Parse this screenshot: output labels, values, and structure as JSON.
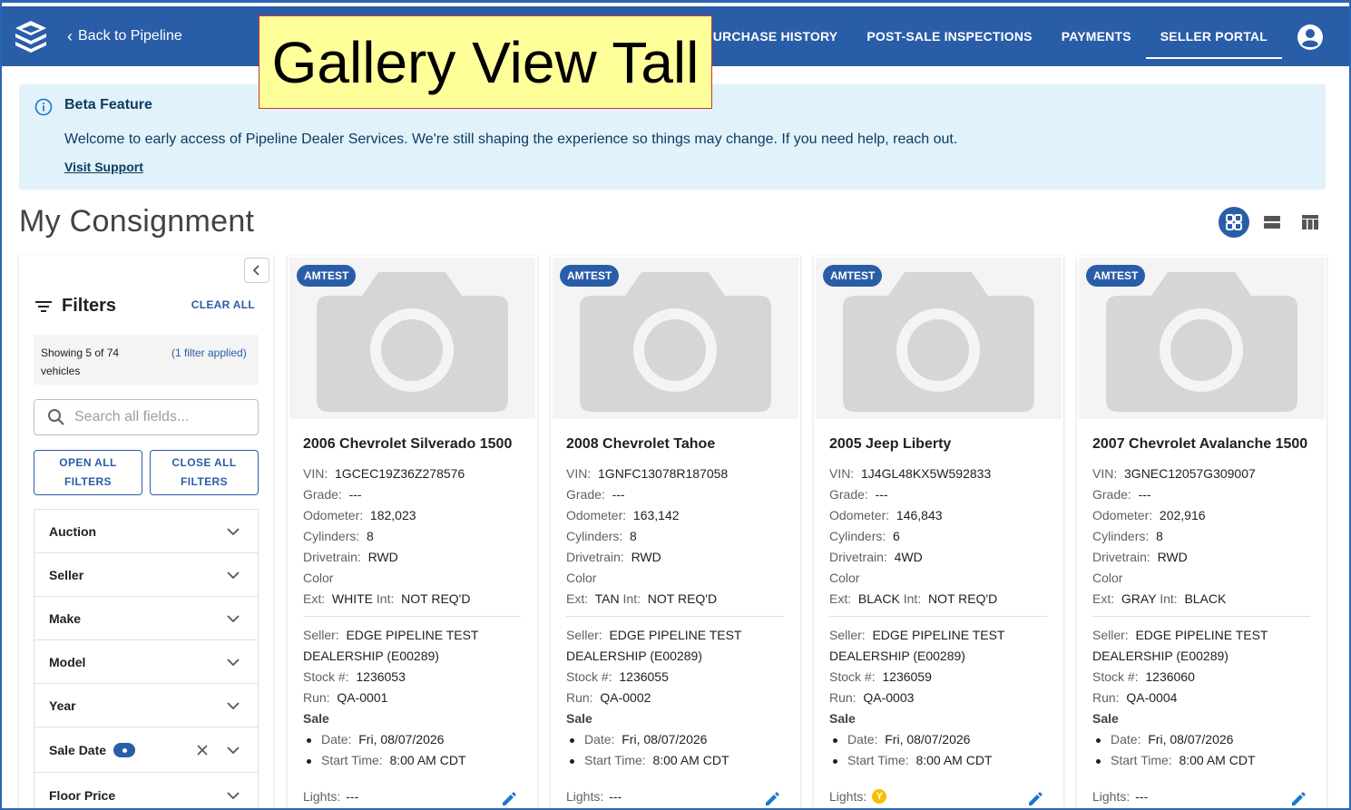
{
  "overlay_label": "Gallery View Tall",
  "header": {
    "back_label": "Back to Pipeline",
    "nav": [
      "PURCHASE HISTORY",
      "POST-SALE INSPECTIONS",
      "PAYMENTS",
      "SELLER PORTAL"
    ],
    "active_nav": "SELLER PORTAL"
  },
  "banner": {
    "title": "Beta Feature",
    "message": "Welcome to early access of Pipeline Dealer Services. We're still shaping the experience so things may change. If you need help, reach out.",
    "link": "Visit Support"
  },
  "page_title": "My Consignment",
  "view_modes": {
    "active": "gallery",
    "icons": [
      "grid-view-icon",
      "list-view-icon",
      "table-view-icon"
    ]
  },
  "sidebar": {
    "title": "Filters",
    "clear_all": "CLEAR ALL",
    "showing": "Showing 5 of 74 vehicles",
    "filter_applied": "(1 filter applied)",
    "search_placeholder": "Search all fields...",
    "open_all": "OPEN ALL FILTERS",
    "close_all": "CLOSE ALL FILTERS",
    "filters": [
      "Auction",
      "Seller",
      "Make",
      "Model",
      "Year",
      "Sale Date",
      "Floor Price"
    ]
  },
  "labels": {
    "vin": "VIN:",
    "grade": "Grade:",
    "odometer": "Odometer:",
    "cylinders": "Cylinders:",
    "drivetrain": "Drivetrain:",
    "color": "Color",
    "ext": "Ext:",
    "int": "Int:",
    "seller": "Seller:",
    "stock": "Stock #:",
    "run": "Run:",
    "sale": "Sale",
    "date": "Date:",
    "start_time": "Start Time:",
    "lights": "Lights:"
  },
  "cards": [
    {
      "tag": "AMTEST",
      "title": "2006 Chevrolet Silverado 1500",
      "vin": "1GCEC19Z36Z278576",
      "grade": "---",
      "odometer": "182,023",
      "cylinders": "8",
      "drivetrain": "RWD",
      "ext": "WHITE",
      "int": "NOT REQ'D",
      "seller_1": "EDGE PIPELINE TEST",
      "seller_2": "DEALERSHIP (E00289)",
      "stock": "1236053",
      "run": "QA-0001",
      "date": "Fri, 08/07/2026",
      "start_time": "8:00 AM CDT",
      "lights": "---"
    },
    {
      "tag": "AMTEST",
      "title": "2008 Chevrolet Tahoe",
      "vin": "1GNFC13078R187058",
      "grade": "---",
      "odometer": "163,142",
      "cylinders": "8",
      "drivetrain": "RWD",
      "ext": "TAN",
      "int": "NOT REQ'D",
      "seller_1": "EDGE PIPELINE TEST",
      "seller_2": "DEALERSHIP (E00289)",
      "stock": "1236055",
      "run": "QA-0002",
      "date": "Fri, 08/07/2026",
      "start_time": "8:00 AM CDT",
      "lights": "---"
    },
    {
      "tag": "AMTEST",
      "title": "2005 Jeep Liberty",
      "vin": "1J4GL48KX5W592833",
      "grade": "---",
      "odometer": "146,843",
      "cylinders": "6",
      "drivetrain": "4WD",
      "ext": "BLACK",
      "int": "NOT REQ'D",
      "seller_1": "EDGE PIPELINE TEST",
      "seller_2": "DEALERSHIP (E00289)",
      "stock": "1236059",
      "run": "QA-0003",
      "date": "Fri, 08/07/2026",
      "start_time": "8:00 AM CDT",
      "lights": "Y"
    },
    {
      "tag": "AMTEST",
      "title": "2007 Chevrolet Avalanche 1500",
      "vin": "3GNEC12057G309007",
      "grade": "---",
      "odometer": "202,916",
      "cylinders": "8",
      "drivetrain": "RWD",
      "ext": "GRAY",
      "int": "BLACK",
      "seller_1": "EDGE PIPELINE TEST",
      "seller_2": "DEALERSHIP (E00289)",
      "stock": "1236060",
      "run": "QA-0004",
      "date": "Fri, 08/07/2026",
      "start_time": "8:00 AM CDT",
      "lights": "---"
    }
  ],
  "colors": {
    "brand": "#2a5da8",
    "banner_bg": "#e1f2fb",
    "light_yellow": "#f5c000"
  }
}
